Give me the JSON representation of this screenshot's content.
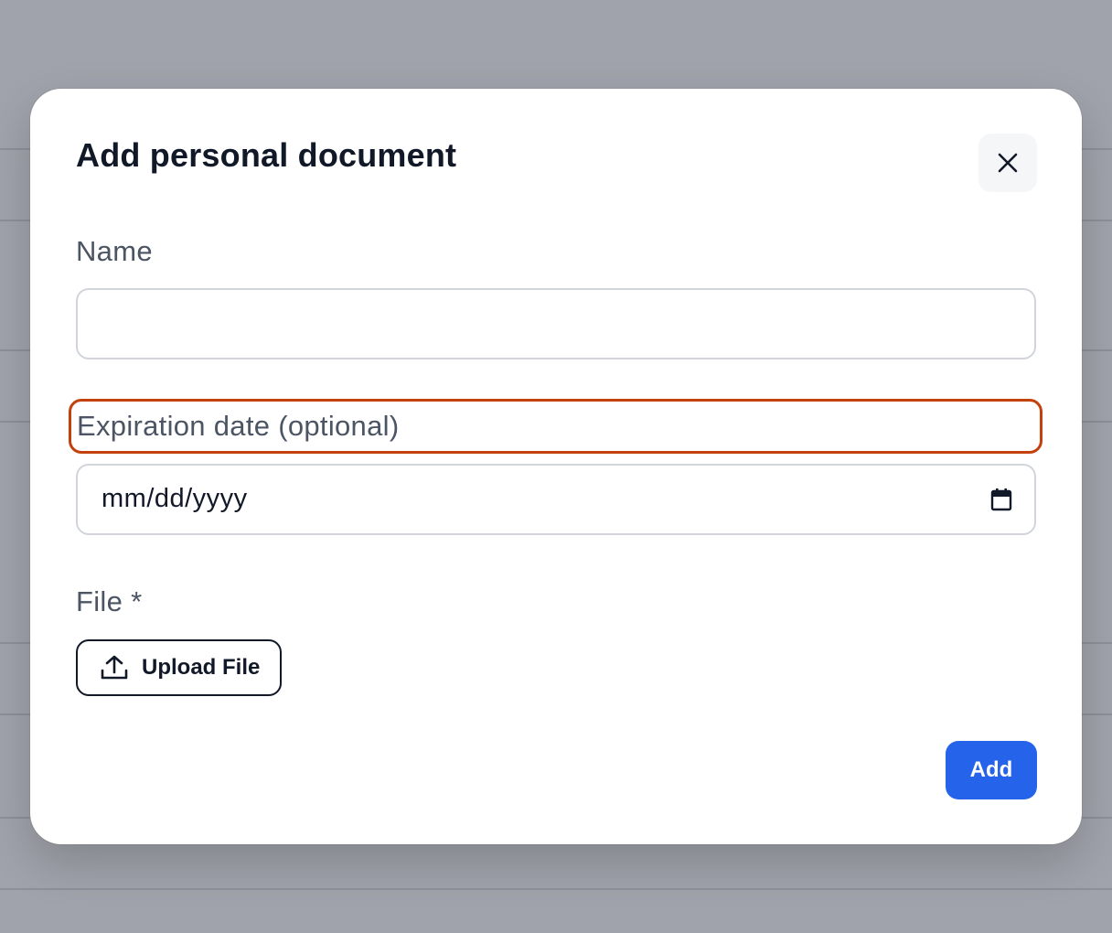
{
  "dialog": {
    "title": "Add personal document",
    "close_icon": "close-icon"
  },
  "fields": {
    "name": {
      "label": "Name",
      "value": "",
      "placeholder": ""
    },
    "expiration": {
      "label": "Expiration date (optional)",
      "placeholder": "mm/dd/yyyy",
      "icon": "calendar-icon"
    },
    "file": {
      "label": "File *",
      "upload_label": "Upload File",
      "upload_icon": "upload-icon"
    }
  },
  "actions": {
    "add_label": "Add"
  },
  "colors": {
    "primary": "#2563eb",
    "highlight": "#c2410c",
    "backdrop": "#a0a3ab"
  }
}
